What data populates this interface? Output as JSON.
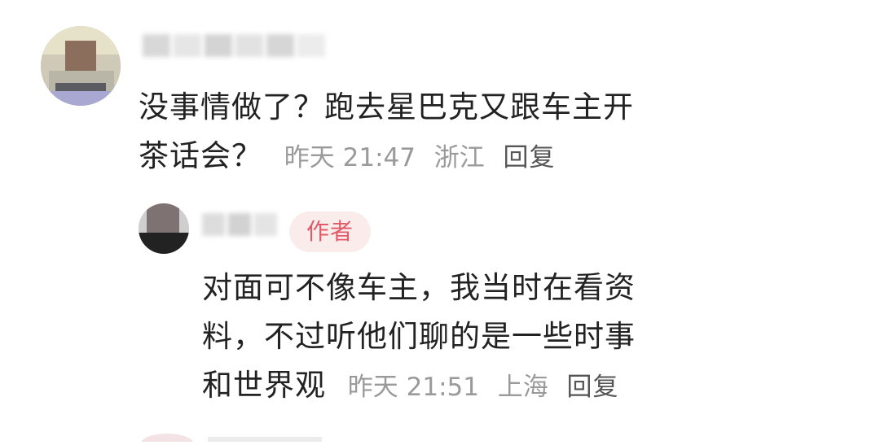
{
  "comments": [
    {
      "text_line1": "没事情做了？跑去星巴克又跟车主开",
      "text_line2": "茶话会？",
      "time": "昨天 21:47",
      "location": "浙江",
      "reply_label": "回复"
    },
    {
      "badge": "作者",
      "text_line1": "对面可不像车主，我当时在看资",
      "text_line2": "料，不过听他们聊的是一些时事",
      "text_line3": "和世界观",
      "time": "昨天 21:51",
      "location": "上海",
      "reply_label": "回复"
    }
  ]
}
